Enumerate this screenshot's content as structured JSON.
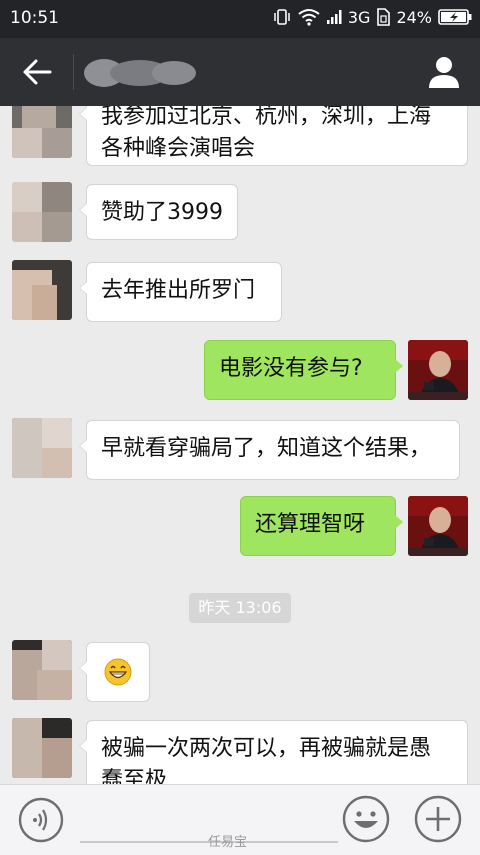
{
  "status_bar": {
    "time": "10:51",
    "network": "3G",
    "battery": "24%",
    "icons": [
      "vibrate-icon",
      "wifi-icon",
      "signal-icon",
      "sim-icon",
      "battery-icon"
    ]
  },
  "header": {
    "back_icon": "arrow-left-icon",
    "contact_icon": "person-icon"
  },
  "messages": [
    {
      "side": "in",
      "text_lines": [
        "我参加过北京、杭州，深圳，上海",
        "各种峰会演唱会"
      ]
    },
    {
      "side": "in",
      "text": "赞助了3999"
    },
    {
      "side": "in",
      "text": "去年推出所罗门"
    },
    {
      "side": "out",
      "text": "电影没有参与?"
    },
    {
      "side": "in",
      "text": "早就看穿骗局了，知道这个结果，"
    },
    {
      "side": "out",
      "text": "还算理智呀"
    },
    {
      "side": "timestamp",
      "text": "昨天 13:06"
    },
    {
      "side": "in",
      "emoji": "grin-emoji-icon"
    },
    {
      "side": "in",
      "text_lines": [
        "被骗一次两次可以，再被骗就是愚",
        "蠢至极"
      ]
    }
  ],
  "input_bar": {
    "voice_icon": "voice-icon",
    "emoji_icon": "emoji-icon",
    "plus_icon": "plus-icon"
  },
  "watermark": "任易宝",
  "colors": {
    "status_bg": "#232428",
    "title_bg": "#2f3034",
    "chat_bg": "#ebebeb",
    "outgoing_bubble": "#9fe55f",
    "incoming_bubble": "#ffffff"
  }
}
